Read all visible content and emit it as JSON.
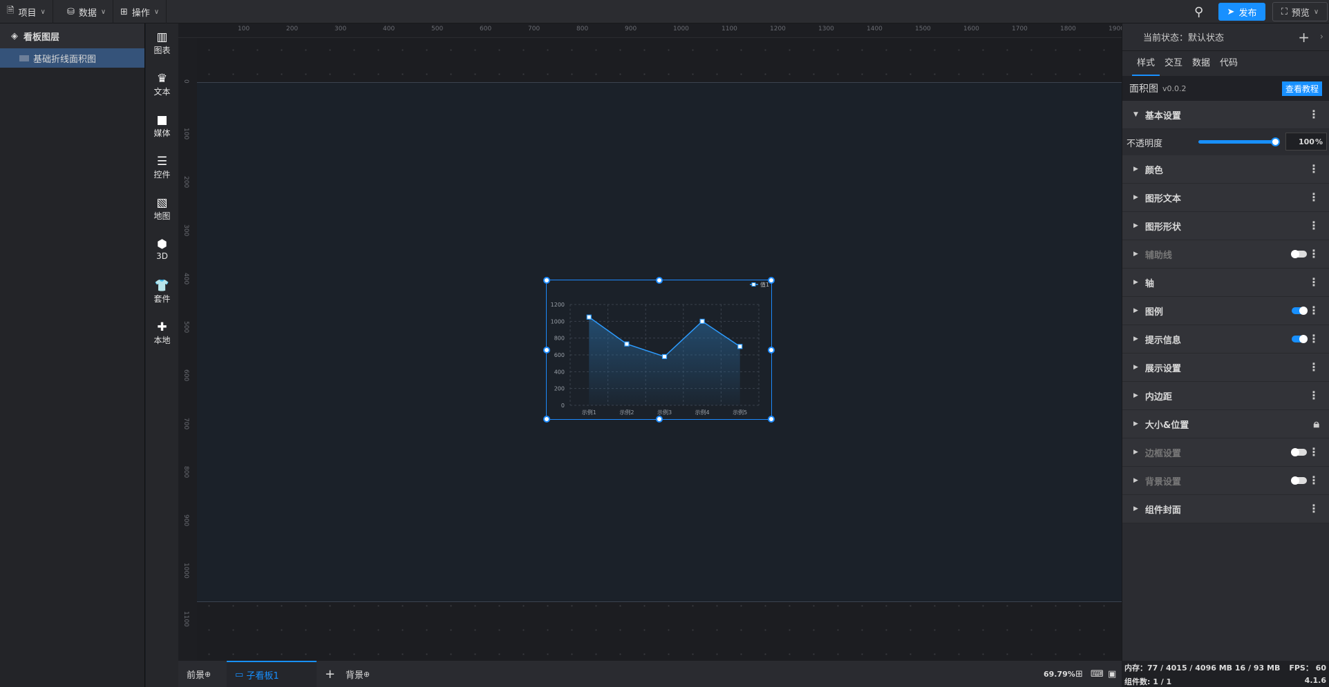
{
  "topbar": {
    "menus": [
      "项目",
      "数据",
      "操作"
    ],
    "publish": "发布",
    "preview": "预览"
  },
  "layers": {
    "title": "看板图层",
    "items": [
      "基础折线面积图"
    ]
  },
  "iconbar": [
    "图表",
    "文本",
    "媒体",
    "控件",
    "地图",
    "3D",
    "套件",
    "本地"
  ],
  "ruler": {
    "h": [
      "100",
      "200",
      "300",
      "400",
      "500",
      "600",
      "700",
      "800",
      "900",
      "1000",
      "1100",
      "1200",
      "1300",
      "1400",
      "1500",
      "1600",
      "1700",
      "1800",
      "1900"
    ],
    "v": [
      "0",
      "100",
      "200",
      "300",
      "400",
      "500",
      "600",
      "700",
      "800",
      "900",
      "1000",
      "1100"
    ]
  },
  "chart_data": {
    "type": "area",
    "categories": [
      "示例1",
      "示例2",
      "示例3",
      "示例4",
      "示例5"
    ],
    "series": [
      {
        "name": "值1",
        "values": [
          1050,
          730,
          580,
          1000,
          700
        ]
      }
    ],
    "ylim": [
      0,
      1200
    ],
    "yticks": [
      "0",
      "200",
      "400",
      "600",
      "800",
      "1000",
      "1200"
    ],
    "legend": "top-right",
    "grid": true,
    "color": "#2d9cff"
  },
  "bottom": {
    "front": "前景",
    "board": "子看板1",
    "back": "背景",
    "zoom": "69.79%"
  },
  "status": {
    "memory": "内存：77 / 4015 / 4096 MB  16 / 93 MB",
    "fps": "FPS： 60",
    "count": "组件数: 1 / 1",
    "version": "4.1.6"
  },
  "panel": {
    "state": "当前状态：默认状态",
    "tabs": [
      "样式",
      "交互",
      "数据",
      "代码"
    ],
    "comp_name": "面积图",
    "comp_version": "v0.0.2",
    "tutorial": "查看教程",
    "basic": "基本设置",
    "opacity_label": "不透明度",
    "opacity_value": "100",
    "opacity_unit": "%",
    "opacity": 100,
    "sections": [
      {
        "label": "颜色"
      },
      {
        "label": "图形文本"
      },
      {
        "label": "图形形状"
      },
      {
        "label": "辅助线",
        "toggle": "off",
        "dim": true
      },
      {
        "label": "轴"
      },
      {
        "label": "图例",
        "toggle": "on"
      },
      {
        "label": "提示信息",
        "toggle": "on"
      },
      {
        "label": "展示设置"
      },
      {
        "label": "内边距"
      },
      {
        "label": "大小&位置",
        "lock": true
      },
      {
        "label": "边框设置",
        "toggle": "off",
        "dim": true
      },
      {
        "label": "背景设置",
        "toggle": "off",
        "dim": true
      },
      {
        "label": "组件封面"
      }
    ]
  }
}
